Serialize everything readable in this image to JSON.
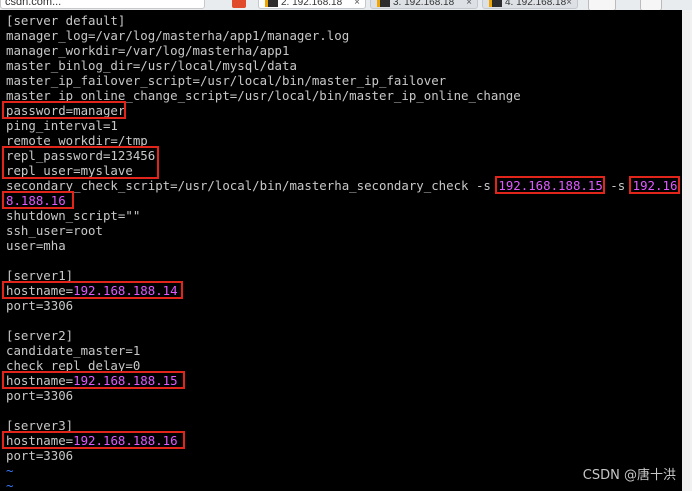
{
  "browser": {
    "address_text": "csdn.com...",
    "tabs": [
      {
        "label": "2. 192.168.18",
        "close": "×"
      },
      {
        "label": "3. 192.168.18",
        "close": "×"
      },
      {
        "label": "4. 192.168.18",
        "close": "×"
      }
    ]
  },
  "terminal": {
    "lines": [
      [
        {
          "t": "[server default]"
        }
      ],
      [
        {
          "t": "manager_log=/var/log/masterha/app1/manager.log"
        }
      ],
      [
        {
          "t": "manager_workdir=/var/log/masterha/app1"
        }
      ],
      [
        {
          "t": "master_binlog_dir=/usr/local/mysql/data"
        }
      ],
      [
        {
          "t": "master_ip_failover_script=/usr/local/bin/master_ip_failover"
        }
      ],
      [
        {
          "t": "master_ip_online_change_script=/usr/local/bin/master_ip_online_change"
        }
      ],
      [
        {
          "t": "password=manager"
        }
      ],
      [
        {
          "t": "ping_interval=1"
        }
      ],
      [
        {
          "t": "remote_workdir=/tmp"
        }
      ],
      [
        {
          "t": "repl_password=123456"
        }
      ],
      [
        {
          "t": "repl_user=myslave"
        }
      ],
      [
        {
          "t": "secondary_check_script=/usr/local/bin/masterha_secondary_check -s "
        },
        {
          "t": "192.168.188.15",
          "ip": true
        },
        {
          "t": " -s "
        },
        {
          "t": "192.16",
          "ip": true
        }
      ],
      [
        {
          "t": "8.188.16",
          "ip": true
        }
      ],
      [
        {
          "t": "shutdown_script=\"\""
        }
      ],
      [
        {
          "t": "ssh_user=root"
        }
      ],
      [
        {
          "t": "user=mha"
        }
      ],
      [
        {
          "t": ""
        }
      ],
      [
        {
          "t": "[server1]"
        }
      ],
      [
        {
          "t": "hostname="
        },
        {
          "t": "192.168.188.14",
          "ip": true
        }
      ],
      [
        {
          "t": "port=3306"
        }
      ],
      [
        {
          "t": ""
        }
      ],
      [
        {
          "t": "[server2]"
        }
      ],
      [
        {
          "t": "candidate_master=1"
        }
      ],
      [
        {
          "t": "check_repl_delay=0"
        }
      ],
      [
        {
          "t": "hostname="
        },
        {
          "t": "192.168.188.15",
          "ip": true
        }
      ],
      [
        {
          "t": "port=3306"
        }
      ],
      [
        {
          "t": ""
        }
      ],
      [
        {
          "t": "[server3]"
        }
      ],
      [
        {
          "t": "hostname="
        },
        {
          "t": "192.168.188.16",
          "ip": true
        }
      ],
      [
        {
          "t": "port=3306"
        }
      ],
      [
        {
          "t": "~",
          "tilde": true
        }
      ],
      [
        {
          "t": "~",
          "tilde": true
        }
      ]
    ]
  },
  "watermark": "CSDN @唐十洪",
  "colors": {
    "terminal_bg": "#000000",
    "terminal_text": "#c8c8c8",
    "ip_highlight": "#e05bff",
    "annotation_box": "#e2251b",
    "tilde": "#3a78ff"
  }
}
